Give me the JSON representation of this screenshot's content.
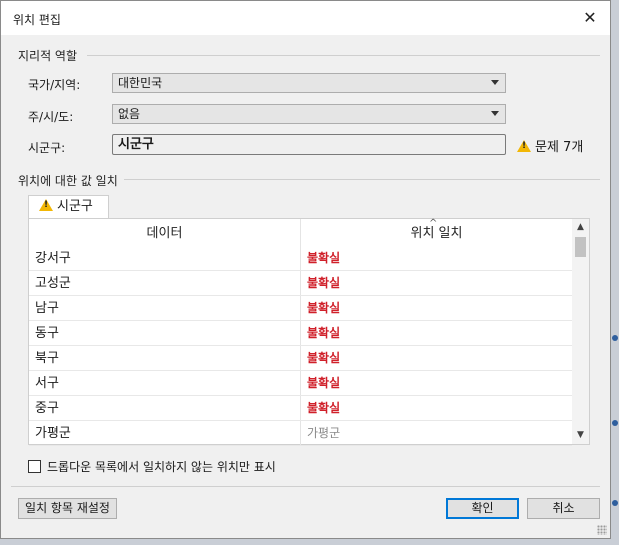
{
  "window": {
    "title": "위치 편집",
    "close_glyph": "✕"
  },
  "geo_section": {
    "label": "지리적 역할",
    "country_label": "국가/지역:",
    "country_value": "대한민국",
    "state_label": "주/시/도:",
    "state_value": "없음",
    "county_label": "시군구:",
    "county_value": "시군구",
    "issues_text": "문제 7개"
  },
  "match_section": {
    "label": "위치에 대한 값 일치",
    "tab_label": "시군구",
    "columns": [
      "데이터",
      "위치 일치"
    ],
    "rows": [
      {
        "data": "강서구",
        "match": "불확실",
        "status": "uncertain"
      },
      {
        "data": "고성군",
        "match": "불확실",
        "status": "uncertain"
      },
      {
        "data": "남구",
        "match": "불확실",
        "status": "uncertain"
      },
      {
        "data": "동구",
        "match": "불확실",
        "status": "uncertain"
      },
      {
        "data": "북구",
        "match": "불확실",
        "status": "uncertain"
      },
      {
        "data": "서구",
        "match": "불확실",
        "status": "uncertain"
      },
      {
        "data": "중구",
        "match": "불확실",
        "status": "uncertain"
      },
      {
        "data": "가평군",
        "match": "가평군",
        "status": "matched"
      }
    ]
  },
  "checkbox_label": "드롭다운 목록에서 일치하지 않는 위치만 표시",
  "buttons": {
    "reset": "일치 항목 재설정",
    "ok": "확인",
    "cancel": "취소"
  },
  "colors": {
    "uncertain": "#d0202a",
    "warning": "#f2b705",
    "accent": "#0078d7"
  }
}
